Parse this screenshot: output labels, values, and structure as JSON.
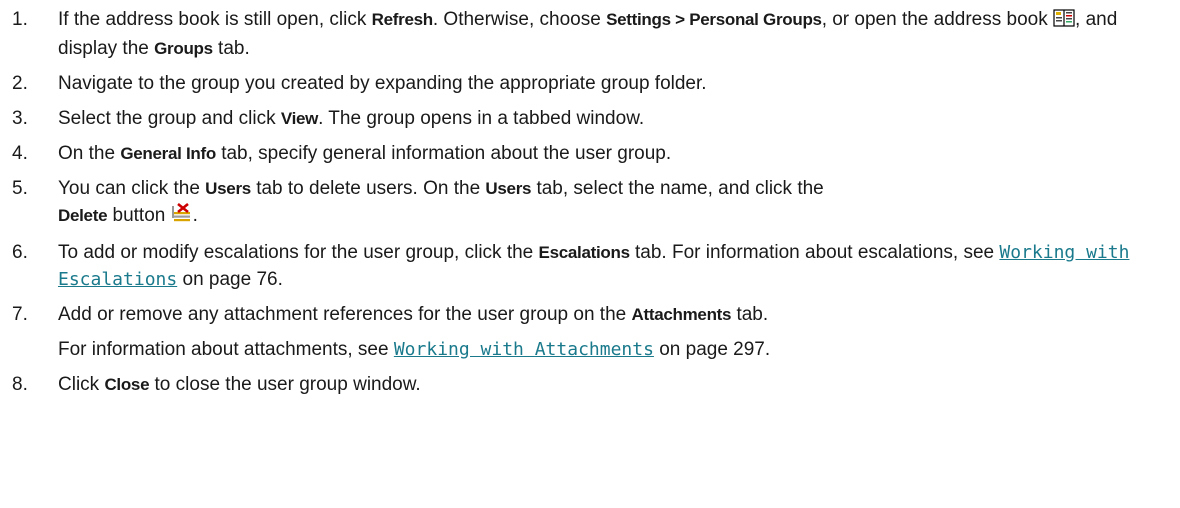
{
  "steps": [
    {
      "num": "1.",
      "t1": "If the address book is still open, click ",
      "b1": "Refresh",
      "t2": ". Otherwise, choose ",
      "b2": "Settings > Personal Groups",
      "t3": ", or open the address book ",
      "t4": ", and display the ",
      "b3": "Groups",
      "t5": " tab.",
      "icon": "address-book-icon"
    },
    {
      "num": "2.",
      "t1": "Navigate to the group you created by expanding the appropriate group folder."
    },
    {
      "num": "3.",
      "t1": "Select the group and click ",
      "b1": "View",
      "t2": ". The group opens in a tabbed window."
    },
    {
      "num": "4.",
      "t1": "On the ",
      "b1": "General Info",
      "t2": " tab, specify general information about the user group."
    },
    {
      "num": "5.",
      "t1": "You can click the ",
      "b1": "Users",
      "t2": " tab to delete users. On the ",
      "b2": "Users",
      "t3": " tab, select the name, and click the ",
      "b3": "Delete",
      "t4": " button ",
      "t5": ".",
      "icon": "delete-user-icon"
    },
    {
      "num": "6.",
      "t1": "To add or modify escalations for the user group, click the ",
      "b1": "Escalations",
      "t2": " tab. For information about escalations, see ",
      "link": "Working with Escalations",
      "t3": " on page 76."
    },
    {
      "num": "7.",
      "t1": "Add or remove any attachment references for the user group on the ",
      "b1": "Attachments",
      "t2": " tab.",
      "s1": "For information about attachments, see ",
      "link": "Working with Attachments",
      "s2": " on page 297."
    },
    {
      "num": "8.",
      "t1": "Click ",
      "b1": "Close",
      "t2": " to close the user group window."
    }
  ],
  "colors": {
    "link": "#1a7a8c",
    "text": "#1a1a1a"
  }
}
